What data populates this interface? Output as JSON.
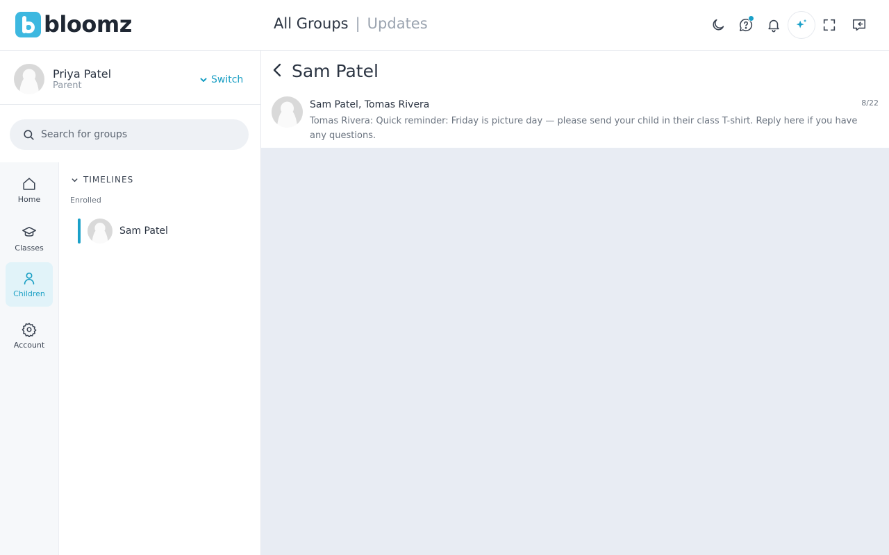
{
  "brand": {
    "name": "bloomz"
  },
  "top_nav": {
    "all_groups": "All Groups",
    "separator": "|",
    "updates": "Updates"
  },
  "header_icons": [
    "moon-icon",
    "help-chat-icon",
    "bell-icon",
    "sparkle-icon",
    "fullscreen-icon",
    "collapse-panel-icon"
  ],
  "profile": {
    "name": "Priya Patel",
    "role": "Parent",
    "switch_label": "Switch"
  },
  "search": {
    "placeholder": "Search for groups",
    "value": ""
  },
  "rail": {
    "items": [
      {
        "label": "Home",
        "icon": "home-icon"
      },
      {
        "label": "Classes",
        "icon": "graduation-cap-icon"
      },
      {
        "label": "Children",
        "icon": "person-icon",
        "active": true
      },
      {
        "label": "Account",
        "icon": "gear-icon"
      }
    ]
  },
  "timelines": {
    "heading": "TIMELINES",
    "section": "Enrolled",
    "children": [
      {
        "name": "Sam Patel",
        "selected": true
      }
    ]
  },
  "main": {
    "title": "Sam Patel",
    "messages": [
      {
        "from": "Sam Patel, Tomas Rivera",
        "body": "Tomas Rivera: Quick reminder: Friday is picture day — please send your child in their class T-shirt. Reply here if you have any questions.",
        "date": "8/22"
      }
    ]
  },
  "colors": {
    "accent": "#1aa0c8",
    "logo": "#3db8e0",
    "content_bg": "#e8ecf3",
    "rail_bg": "#f6f8fa"
  }
}
